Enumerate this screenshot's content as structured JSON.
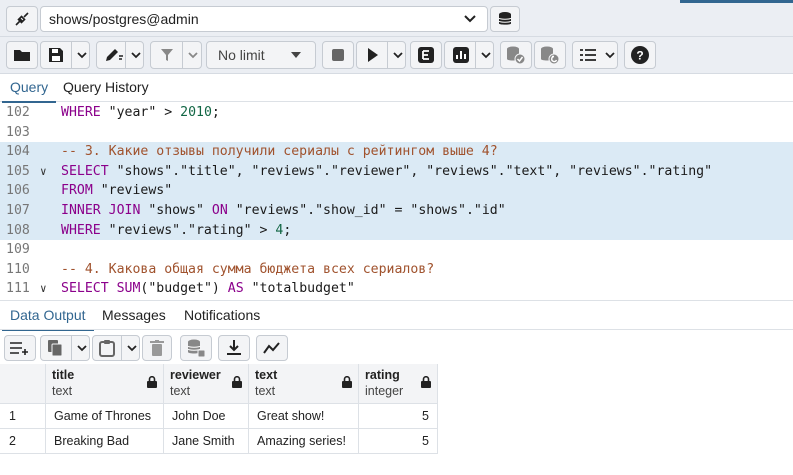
{
  "connection": {
    "label": "shows/postgres@admin"
  },
  "toolbar": {
    "limit_label": "No limit"
  },
  "editor_tabs": [
    {
      "label": "Query",
      "active": true
    },
    {
      "label": "Query History",
      "active": false
    }
  ],
  "editor": {
    "lines": [
      {
        "num": "102",
        "fold": "",
        "hl": false,
        "tokens": [
          [
            "kw",
            "WHERE"
          ],
          [
            "str",
            " \"year\" "
          ],
          [
            "str",
            "> "
          ],
          [
            "num-lit",
            "2010"
          ],
          [
            "str",
            ";"
          ]
        ]
      },
      {
        "num": "103",
        "fold": "",
        "hl": false,
        "tokens": []
      },
      {
        "num": "104",
        "fold": "",
        "hl": true,
        "tokens": [
          [
            "cm",
            "-- 3. Какие отзывы получили сериалы с рейтингом выше 4?"
          ]
        ]
      },
      {
        "num": "105",
        "fold": "∨",
        "hl": true,
        "tokens": [
          [
            "kw",
            "SELECT"
          ],
          [
            "str",
            " \"shows\".\"title\", \"reviews\".\"reviewer\", \"reviews\".\"text\", \"reviews\".\"rating\""
          ]
        ]
      },
      {
        "num": "106",
        "fold": "",
        "hl": true,
        "tokens": [
          [
            "kw",
            "FROM"
          ],
          [
            "str",
            " \"reviews\""
          ]
        ]
      },
      {
        "num": "107",
        "fold": "",
        "hl": true,
        "tokens": [
          [
            "kw",
            "INNER JOIN"
          ],
          [
            "str",
            " \"shows\" "
          ],
          [
            "kw",
            "ON"
          ],
          [
            "str",
            " \"reviews\".\"show_id\" = \"shows\".\"id\""
          ]
        ]
      },
      {
        "num": "108",
        "fold": "",
        "hl": true,
        "tokens": [
          [
            "kw",
            "WHERE"
          ],
          [
            "str",
            " \"reviews\".\"rating\" > "
          ],
          [
            "num-lit",
            "4"
          ],
          [
            "str",
            ";"
          ]
        ]
      },
      {
        "num": "109",
        "fold": "",
        "hl": false,
        "tokens": []
      },
      {
        "num": "110",
        "fold": "",
        "hl": false,
        "tokens": [
          [
            "cm",
            "-- 4. Какова общая сумма бюджета всех сериалов?"
          ]
        ]
      },
      {
        "num": "111",
        "fold": "∨",
        "hl": false,
        "tokens": [
          [
            "kw",
            "SELECT"
          ],
          [
            "str",
            " "
          ],
          [
            "kw",
            "SUM"
          ],
          [
            "str",
            "(\"budget\") "
          ],
          [
            "kw",
            "AS"
          ],
          [
            "str",
            " \"totalbudget\""
          ]
        ]
      }
    ]
  },
  "output_tabs": [
    {
      "label": "Data Output",
      "active": true
    },
    {
      "label": "Messages",
      "active": false
    },
    {
      "label": "Notifications",
      "active": false
    }
  ],
  "grid": {
    "columns": [
      {
        "name": "title",
        "type": "text"
      },
      {
        "name": "reviewer",
        "type": "text"
      },
      {
        "name": "text",
        "type": "text"
      },
      {
        "name": "rating",
        "type": "integer"
      }
    ],
    "rows": [
      {
        "n": "1",
        "cells": [
          "Game of Thrones",
          "John Doe",
          "Great show!",
          "5"
        ]
      },
      {
        "n": "2",
        "cells": [
          "Breaking Bad",
          "Jane Smith",
          "Amazing series!",
          "5"
        ]
      }
    ]
  }
}
